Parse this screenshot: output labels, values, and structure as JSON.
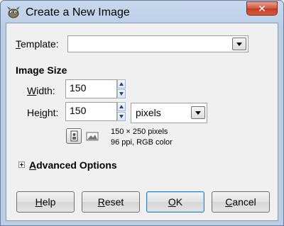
{
  "window": {
    "title": "Create a New Image",
    "close_glyph": "✕",
    "app_icon": "gimp-icon"
  },
  "template": {
    "label_mnemonic": "T",
    "label_rest": "emplate:",
    "value": ""
  },
  "image_size": {
    "title": "Image Size",
    "width_label_mnemonic": "W",
    "width_label_rest": "idth:",
    "width_value": "150",
    "height_label_first": "He",
    "height_label_mnemonic": "i",
    "height_label_rest": "ght:",
    "height_value": "150",
    "unit": "pixels",
    "info_line1": "150 × 250 pixels",
    "info_line2": "96 ppi, RGB color",
    "orientation_icons": [
      "portrait-icon",
      "landscape-icon"
    ]
  },
  "advanced": {
    "label_mnemonic": "A",
    "label_rest": "dvanced Options"
  },
  "buttons": {
    "help_mnemonic": "H",
    "help_rest": "elp",
    "reset_mnemonic": "R",
    "reset_rest": "eset",
    "ok_mnemonic": "O",
    "ok_rest": "K",
    "cancel_first": "",
    "cancel_mnemonic": "C",
    "cancel_rest": "ancel"
  },
  "colors": {
    "title_bg": "#b9cde6",
    "dialog_bg": "#f0f0f0",
    "close_red": "#c23d26",
    "default_button_border": "#3c7fb1"
  }
}
